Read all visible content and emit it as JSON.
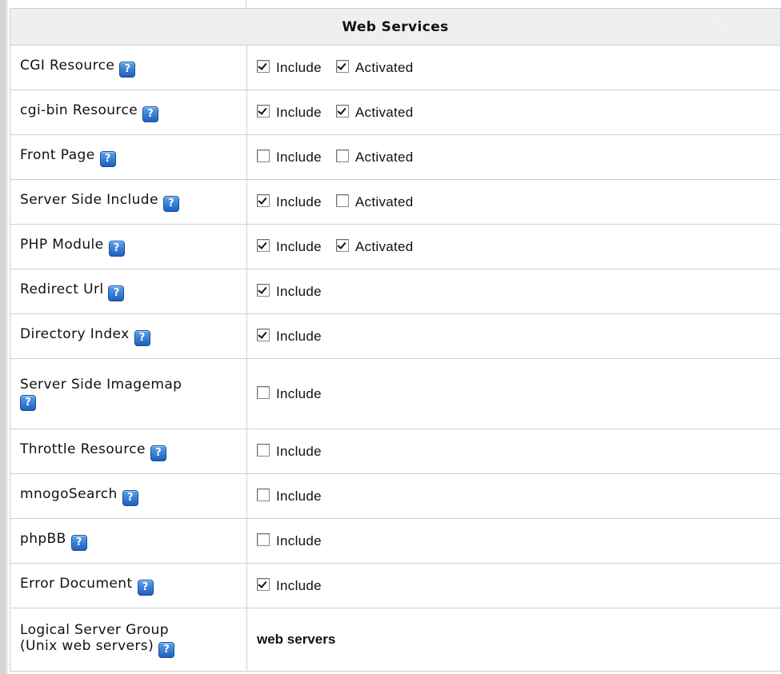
{
  "section_title": "Web Services",
  "help_glyph": "?",
  "labels": {
    "include": "Include",
    "activated": "Activated"
  },
  "rows": [
    {
      "label": "CGI Resource",
      "include": true,
      "activated": true
    },
    {
      "label": "cgi-bin Resource",
      "include": true,
      "activated": true
    },
    {
      "label": "Front Page",
      "include": false,
      "activated": false
    },
    {
      "label": "Server Side Include",
      "include": true,
      "activated": false
    },
    {
      "label": "PHP Module",
      "include": true,
      "activated": true
    },
    {
      "label": "Redirect Url",
      "include": true
    },
    {
      "label": "Directory Index",
      "include": true
    },
    {
      "label": "Server Side Imagemap",
      "include": false
    },
    {
      "label": "Throttle Resource",
      "include": false
    },
    {
      "label": "mnogoSearch",
      "include": false
    },
    {
      "label": "phpBB",
      "include": false
    },
    {
      "label": "Error Document",
      "include": true
    }
  ],
  "logical_group": {
    "label_line1": "Logical Server Group",
    "label_line2": "(Unix web servers)",
    "value": "web servers"
  },
  "colors": {
    "header_bg": "#ebebeb",
    "border": "#cfcfcf",
    "help_icon": "#2a6fce"
  }
}
